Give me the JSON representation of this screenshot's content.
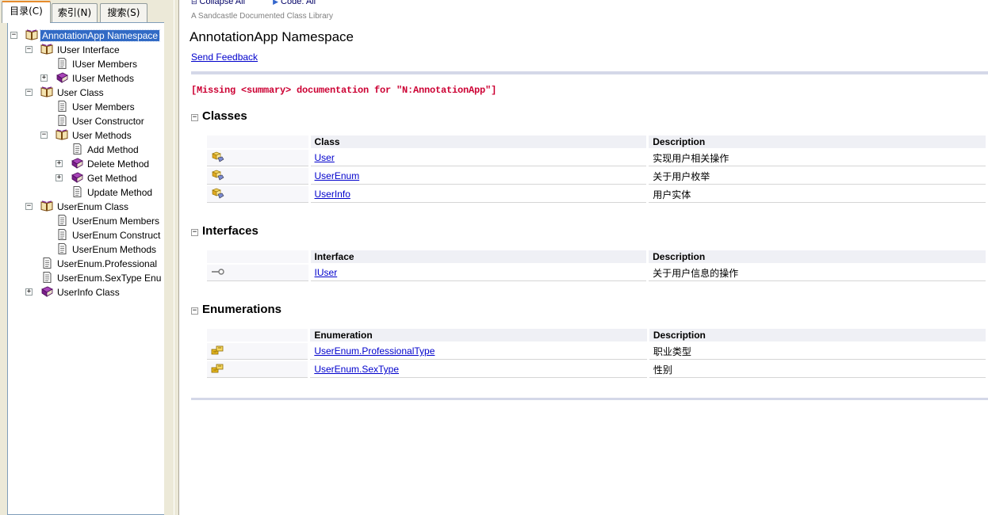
{
  "tabs": [
    {
      "label": "目录(C)"
    },
    {
      "label": "索引(N)"
    },
    {
      "label": "搜索(S)"
    }
  ],
  "tree": [
    {
      "label": "AnnotationApp Namespace",
      "icon": "open-book-icon",
      "expander": "⊟"
    },
    {
      "label": "IUser Interface",
      "icon": "open-book-icon",
      "expander": "⊟"
    },
    {
      "label": "IUser Members",
      "icon": "page-icon",
      "expander": ""
    },
    {
      "label": "IUser Methods",
      "icon": "closed-book-icon",
      "expander": "⊞"
    },
    {
      "label": "User Class",
      "icon": "open-book-icon",
      "expander": "⊟"
    },
    {
      "label": "User Members",
      "icon": "page-icon",
      "expander": ""
    },
    {
      "label": "User Constructor",
      "icon": "page-icon",
      "expander": ""
    },
    {
      "label": "User Methods",
      "icon": "open-book-icon",
      "expander": "⊟"
    },
    {
      "label": "Add Method",
      "icon": "page-icon",
      "expander": ""
    },
    {
      "label": "Delete Method",
      "icon": "closed-book-icon",
      "expander": "⊞"
    },
    {
      "label": "Get Method",
      "icon": "closed-book-icon",
      "expander": "⊞"
    },
    {
      "label": "Update Method",
      "icon": "page-icon",
      "expander": ""
    },
    {
      "label": "UserEnum Class",
      "icon": "open-book-icon",
      "expander": "⊟"
    },
    {
      "label": "UserEnum Members",
      "icon": "page-icon",
      "expander": ""
    },
    {
      "label": "UserEnum Construct",
      "icon": "page-icon",
      "expander": ""
    },
    {
      "label": "UserEnum Methods",
      "icon": "page-icon",
      "expander": ""
    },
    {
      "label": "UserEnum.Professional",
      "icon": "page-icon",
      "expander": ""
    },
    {
      "label": "UserEnum.SexType Enu",
      "icon": "page-icon",
      "expander": ""
    },
    {
      "label": "UserInfo Class",
      "icon": "closed-book-icon",
      "expander": "⊞"
    }
  ],
  "content": {
    "collapse_all": "Collapse All",
    "code_all": "Code: All",
    "library_caption": "A Sandcastle Documented Class Library",
    "title": "AnnotationApp Namespace",
    "feedback": "Send Feedback",
    "missing_summary": "[Missing <summary> documentation for \"N:AnnotationApp\"]",
    "sections": {
      "classes": {
        "title": "Classes",
        "col1": "Class",
        "col2": "Description",
        "rows": [
          {
            "name": "User",
            "desc": "实现用户相关操作"
          },
          {
            "name": "UserEnum",
            "desc": "关于用户枚举"
          },
          {
            "name": "UserInfo",
            "desc": "用户实体"
          }
        ]
      },
      "interfaces": {
        "title": "Interfaces",
        "col1": "Interface",
        "col2": "Description",
        "rows": [
          {
            "name": "IUser",
            "desc": "关于用户信息的操作"
          }
        ]
      },
      "enumerations": {
        "title": "Enumerations",
        "col1": "Enumeration",
        "col2": "Description",
        "rows": [
          {
            "name": "UserEnum.ProfessionalType",
            "desc": "职业类型"
          },
          {
            "name": "UserEnum.SexType",
            "desc": "性别"
          }
        ]
      }
    }
  },
  "colors": {
    "selection": "#316ac5",
    "link": "#0000cc",
    "missing": "#cc0033",
    "book_purple": "#7a1f8a",
    "book_open": "#c8a050"
  }
}
